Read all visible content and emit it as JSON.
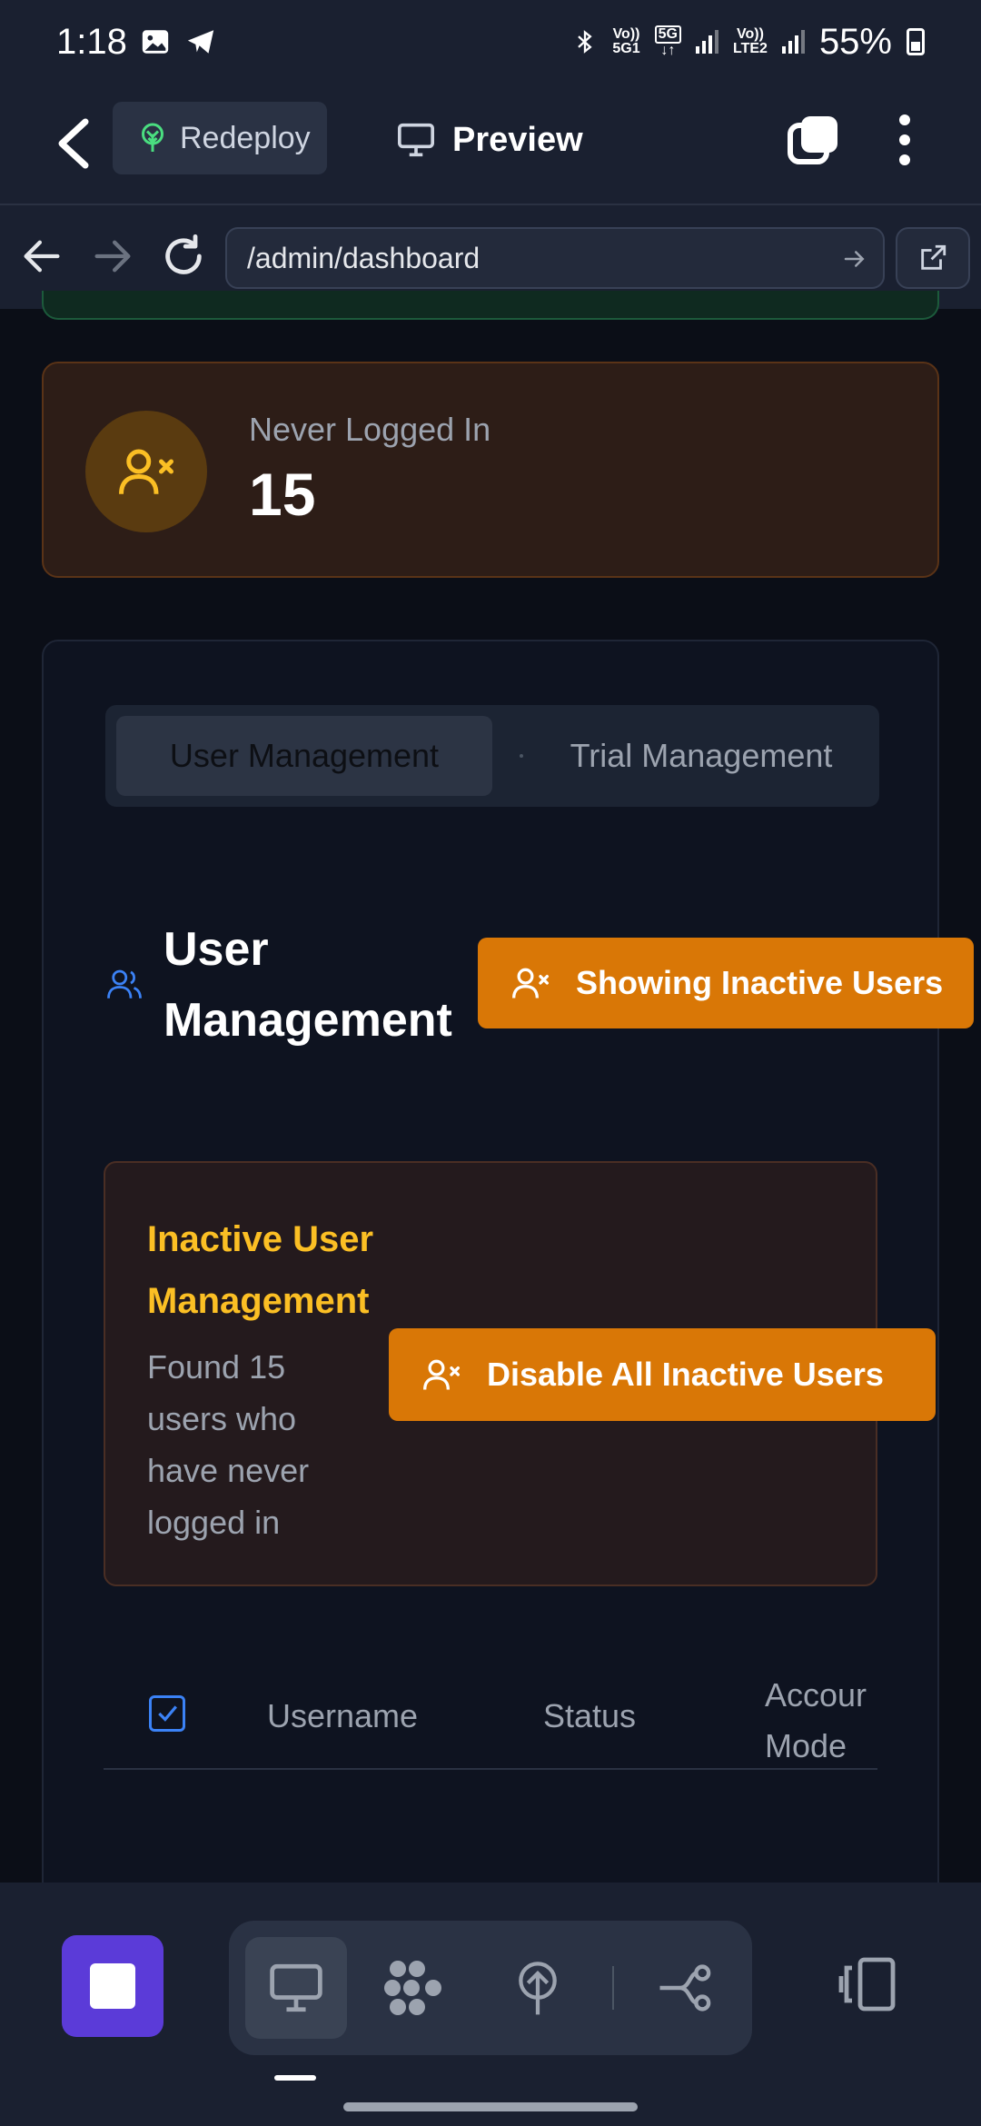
{
  "status_bar": {
    "time": "1:18",
    "net1_top": "Vo))",
    "net1_bottom": "5G1",
    "net_5g": "5G",
    "net2_top": "Vo))",
    "net2_bottom": "LTE2",
    "battery": "55%"
  },
  "header": {
    "redeploy_label": "Redeploy",
    "preview_label": "Preview"
  },
  "browser": {
    "url": "/admin/dashboard"
  },
  "stat_card": {
    "label": "Never Logged In",
    "value": "15"
  },
  "tabs": [
    {
      "label": "User Management",
      "active": true
    },
    {
      "label": "Trial Management",
      "active": false
    }
  ],
  "section": {
    "title": "User Management",
    "filter_button": "Showing Inactive Users"
  },
  "inactive": {
    "title": "Inactive User Management",
    "description": "Found 15 users who have never logged in",
    "disable_button": "Disable All Inactive Users"
  },
  "table": {
    "columns": [
      "Username",
      "Status",
      "Accour Mode"
    ]
  },
  "colors": {
    "accent_orange": "#d97706",
    "title_yellow": "#fbbf24",
    "stop_purple": "#5b3bd8",
    "link_blue": "#3b82f6"
  }
}
